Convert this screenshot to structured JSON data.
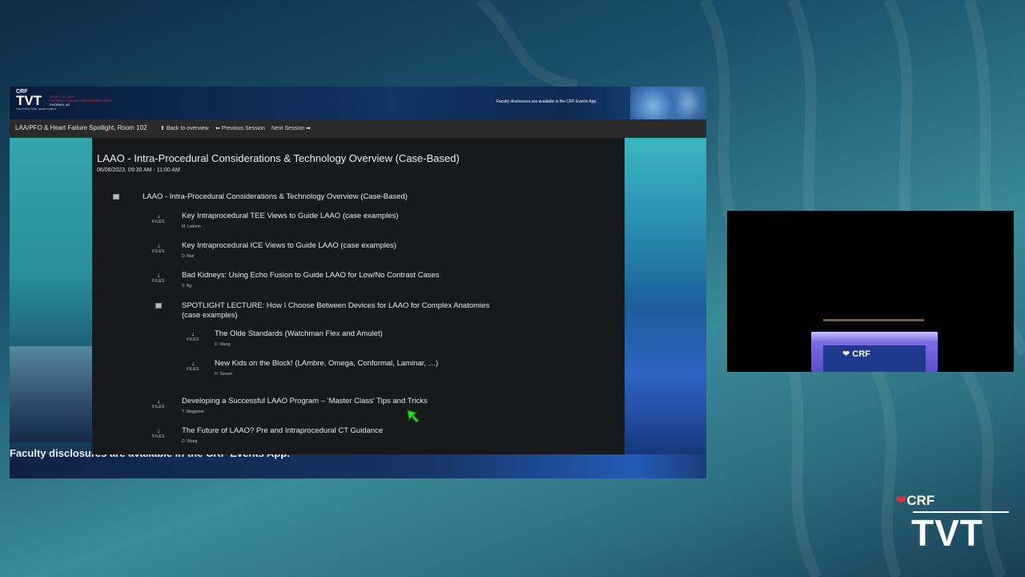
{
  "banner": {
    "brand": "CRF",
    "event": "TVT",
    "event_sub": "THE STRUCTURAL HEART SUMMIT",
    "dates": "JUNE 7-10, 2023",
    "venue": "PHOENIX CONVENTION CENTER • WEST",
    "city": "PHOENIX, AZ",
    "disclosure": "Faculty disclosures are available in the CRF Events App."
  },
  "nav": {
    "room": "LAA/PFO & Heart Failure Spotlight, Room 102",
    "back": "Back to overview",
    "prev": "Previous Session",
    "next": "Next Session"
  },
  "session": {
    "title": "LAAO - Intra-Procedural Considerations & Technology Overview (Case-Based)",
    "datetime": "06/08/2023, 09:30 AM - 11:00 AM"
  },
  "files_label": "FILES",
  "agenda": {
    "section_title": "LAAO - Intra-Procedural Considerations & Technology Overview (Case-Based)",
    "talks": [
      {
        "title": "Key Intraprocedural TEE Views to Guide LAAO (case examples)",
        "author": "M. Lebehn"
      },
      {
        "title": "Key Intraprocedural ICE Views to Guide LAAO (case examples)",
        "author": "D. Nair"
      },
      {
        "title": "Bad Kidneys: Using Echo Fusion to Guide LAAO for Low/No Contrast Cases",
        "author": "V. Ng"
      }
    ],
    "spotlight_title_1": "SPOTLIGHT LECTURE: How I Choose Between Devices for LAAO for Complex Anatomies",
    "spotlight_title_2": "(case examples)",
    "spotlight_talks": [
      {
        "title": "The Olde Standards (Watchman Flex and Amulet)",
        "author": "D. Wang"
      },
      {
        "title": "New Kids on the Block! (LAmbre, Omega, Conformal, Laminar, …)",
        "author": "H. Sievert"
      }
    ],
    "final_talks": [
      {
        "title": "Developing a Successful LAAO Program – 'Master Class' Tips and Tricks",
        "author": "T. Waggoner"
      },
      {
        "title": "The Future of LAAO? Pre and Intraprocedural CT Guidance",
        "author": "D. Wang"
      }
    ]
  },
  "bottom_disclosure": "Faculty disclosures are available in the CRF Events App.",
  "video": {
    "podium_logo": "CRF"
  },
  "corner": {
    "brand": "CRF",
    "event": "TVT"
  },
  "colors": {
    "accent_red": "#e0303a",
    "cursor_green": "#22dd22"
  }
}
